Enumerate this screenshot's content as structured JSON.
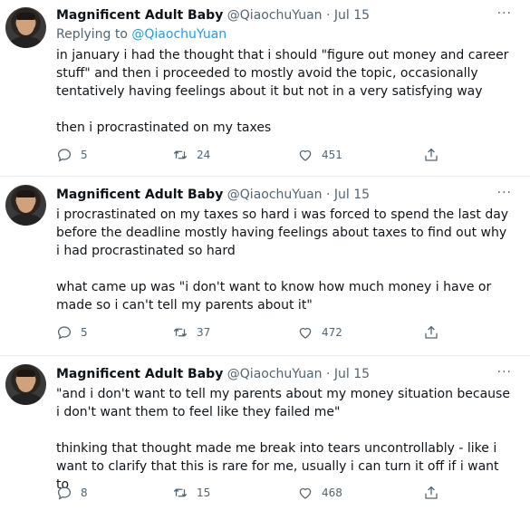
{
  "tweets": [
    {
      "author_name": "Magnificent Adult Baby",
      "author_handle": "@QiaochuYuan",
      "date": "· Jul 15",
      "reply_prefix": "Replying to",
      "reply_handle": "@QiaochuYuan",
      "paragraphs": [
        "in january i had the thought that i should \"figure out money and career stuff\" and then i proceeded to mostly avoid the topic, occasionally tentatively having feelings about it but not in a very satisfying way",
        "then i procrastinated on my taxes"
      ],
      "replies": "5",
      "retweets": "24",
      "likes": "451"
    },
    {
      "author_name": "Magnificent Adult Baby",
      "author_handle": "@QiaochuYuan",
      "date": "· Jul 15",
      "paragraphs": [
        "i procrastinated on my taxes so hard i was forced to spend the last day before the deadline mostly having feelings about taxes to find out why i had procrastinated so hard",
        "what came up was \"i don't want to know how much money i have or made so i can't tell my parents about it\""
      ],
      "replies": "5",
      "retweets": "37",
      "likes": "472"
    },
    {
      "author_name": "Magnificent Adult Baby",
      "author_handle": "@QiaochuYuan",
      "date": "· Jul 15",
      "paragraphs": [
        "\"and i don't want to tell my parents about my money situation because i don't want them to feel like they failed me\"",
        "thinking that thought made me break into tears uncontrollably - like i want to clarify that this is rare for me, usually i can turn it off if i want to"
      ],
      "replies": "8",
      "retweets": "15",
      "likes": "468"
    }
  ],
  "more_glyph": "···",
  "icons": [
    "reply-icon",
    "retweet-icon",
    "like-icon",
    "share-icon",
    "more-icon"
  ]
}
